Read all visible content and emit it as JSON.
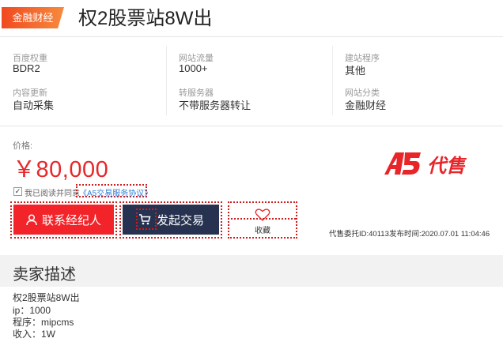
{
  "header": {
    "category_tag": "金融财经",
    "title": "权2股票站8W出"
  },
  "info": {
    "baidu_weight_label": "百度权重",
    "baidu_weight_value": "BDR2",
    "traffic_label": "网站流量",
    "traffic_value": "1000+",
    "program_label": "建站程序",
    "program_value": "其他",
    "content_label": "内容更新",
    "content_value": "自动采集",
    "server_label": "转服务器",
    "server_value": "不带服务器转让",
    "category_label": "网站分类",
    "category_value": "金融财经"
  },
  "pricing": {
    "price_label": "价格:",
    "price": "￥80,000",
    "logo_text": "A5代售"
  },
  "agreement": {
    "text": "我已阅读并同意",
    "link": "《A5交易服务协议》",
    "checked": true
  },
  "actions": {
    "contact_label": "联系经纪人",
    "trade_label": "发起交易",
    "favorite_label": "收藏"
  },
  "meta": {
    "consign_id": "代售委托ID:40113",
    "publish_time": "发布时间:2020.07.01 11:04:46"
  },
  "seller": {
    "section_title": "卖家描述",
    "lines": [
      "权2股票站8W出",
      "ip：1000",
      "程序：mipcms",
      "收入：1W"
    ]
  },
  "colors": {
    "accent_red": "#f2242a",
    "navy": "#26324f",
    "link_blue": "#2b7bd9"
  }
}
